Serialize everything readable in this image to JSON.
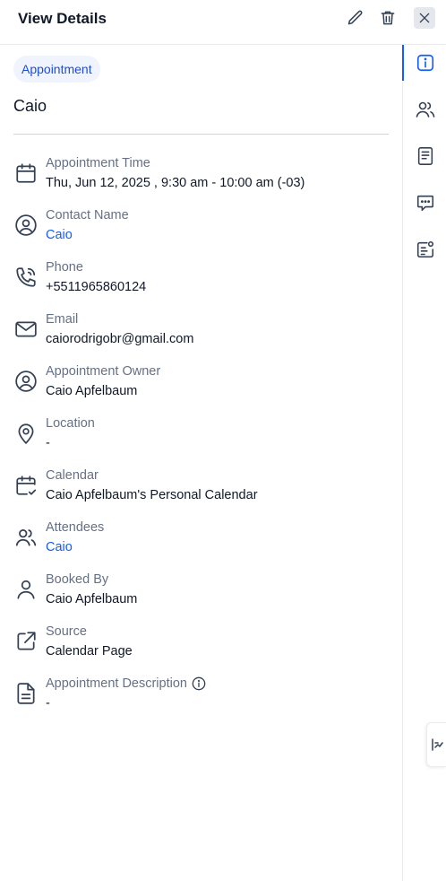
{
  "header": {
    "title": "View Details"
  },
  "badge": "Appointment",
  "contact_title": "Caio",
  "details": [
    {
      "label": "Appointment Time",
      "value": "Thu, Jun 12, 2025 , 9:30 am - 10:00 am (-03)",
      "icon": "calendar-icon",
      "link": false
    },
    {
      "label": "Contact Name",
      "value": "Caio",
      "icon": "user-circle-icon",
      "link": true
    },
    {
      "label": "Phone",
      "value": "+5511965860124",
      "icon": "phone-icon",
      "link": false
    },
    {
      "label": "Email",
      "value": "caiorodrigobr@gmail.com",
      "icon": "mail-icon",
      "link": false
    },
    {
      "label": "Appointment Owner",
      "value": "Caio Apfelbaum",
      "icon": "user-circle-icon",
      "link": false
    },
    {
      "label": "Location",
      "value": "-",
      "icon": "location-pin-icon",
      "link": false
    },
    {
      "label": "Calendar",
      "value": "Caio Apfelbaum's Personal Calendar",
      "icon": "calendar-check-icon",
      "link": false
    },
    {
      "label": "Attendees",
      "value": "Caio",
      "icon": "users-icon",
      "link": true
    },
    {
      "label": "Booked By",
      "value": "Caio Apfelbaum",
      "icon": "user-icon",
      "link": false
    },
    {
      "label": "Source",
      "value": "Calendar Page",
      "icon": "external-link-icon",
      "link": false
    },
    {
      "label": "Appointment Description",
      "value": "-",
      "icon": "document-icon",
      "link": false,
      "info": true
    }
  ],
  "rail": [
    "info-icon",
    "users-icon",
    "notes-icon",
    "chat-icon",
    "contact-card-icon"
  ],
  "colors": {
    "accent": "#155eef",
    "text": "#101828",
    "muted": "#667085",
    "badge_bg": "#eff4ff"
  }
}
